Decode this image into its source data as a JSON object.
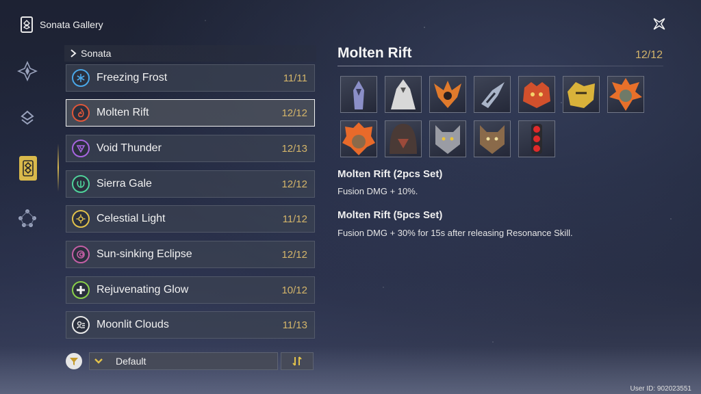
{
  "header": {
    "title": "Sonata Gallery",
    "logo_icon": "sonata-logo-icon",
    "close_icon": "close-icon"
  },
  "sidebar": {
    "items": [
      {
        "icon": "compass-star-icon",
        "active": false
      },
      {
        "icon": "layers-icon",
        "active": false
      },
      {
        "icon": "sonata-card-icon",
        "active": true
      },
      {
        "icon": "network-nodes-icon",
        "active": false
      }
    ]
  },
  "list": {
    "header_label": "Sonata",
    "items": [
      {
        "label": "Freezing Frost",
        "count": "11/11",
        "color": "#4aa7e8",
        "icon": "snowflake-icon"
      },
      {
        "label": "Molten Rift",
        "count": "12/12",
        "color": "#e0573a",
        "icon": "flame-icon",
        "selected": true
      },
      {
        "label": "Void Thunder",
        "count": "12/13",
        "color": "#a765e0",
        "icon": "thunder-icon"
      },
      {
        "label": "Sierra Gale",
        "count": "12/12",
        "color": "#4fd39b",
        "icon": "wind-icon"
      },
      {
        "label": "Celestial Light",
        "count": "11/12",
        "color": "#e2c24b",
        "icon": "sun-icon"
      },
      {
        "label": "Sun-sinking Eclipse",
        "count": "12/12",
        "color": "#c55fa6",
        "icon": "eclipse-icon"
      },
      {
        "label": "Rejuvenating Glow",
        "count": "10/12",
        "color": "#8bd14a",
        "icon": "plus-icon"
      },
      {
        "label": "Moonlit Clouds",
        "count": "11/13",
        "color": "#e8e8e8",
        "icon": "moon-cloud-icon"
      }
    ]
  },
  "filter": {
    "sort_label": "Default"
  },
  "detail": {
    "title": "Molten Rift",
    "count": "12/12",
    "sets": [
      {
        "title": "Molten Rift (2pcs Set)",
        "description": "Fusion DMG + 10%."
      },
      {
        "title": "Molten Rift (5pcs Set)",
        "description": "Fusion DMG + 30% for 15s after releasing Resonance Skill."
      }
    ],
    "echoes": [
      {
        "icon": "echo-purple-figure-icon",
        "tint": "#8b8fc8"
      },
      {
        "icon": "echo-white-figure-icon",
        "tint": "#d8d8d8"
      },
      {
        "icon": "echo-flame-bird-icon",
        "tint": "#e07a2c"
      },
      {
        "icon": "echo-dark-bird-icon",
        "tint": "#a9b4c8"
      },
      {
        "icon": "echo-red-crab-icon",
        "tint": "#d2502c"
      },
      {
        "icon": "echo-gold-beast-icon",
        "tint": "#d9b23a"
      },
      {
        "icon": "echo-flame-lion-icon",
        "tint": "#e8702a"
      },
      {
        "icon": "echo-flame-mane-icon",
        "tint": "#e86a2a"
      },
      {
        "icon": "echo-hooded-figure-icon",
        "tint": "#9b4a3a"
      },
      {
        "icon": "echo-grey-wolf-icon",
        "tint": "#9a9ca4"
      },
      {
        "icon": "echo-brown-wolf-icon",
        "tint": "#8a6a4a"
      },
      {
        "icon": "echo-red-lantern-icon",
        "tint": "#e02a2a"
      }
    ]
  },
  "footer": {
    "user_id": "User ID: 902023551"
  }
}
